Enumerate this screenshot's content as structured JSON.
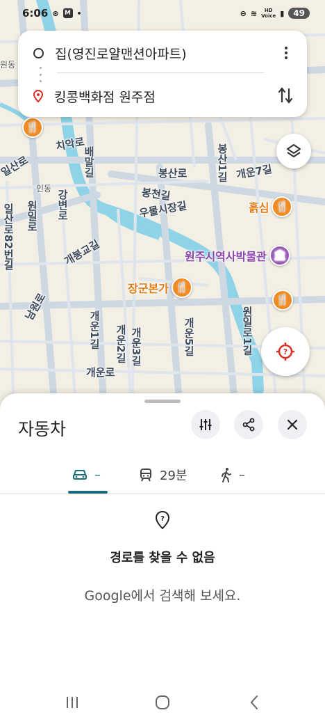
{
  "status_bar": {
    "time": "6:06",
    "battery": "49",
    "hd_label": "HD",
    "voice_label": "Voice",
    "m_badge": "M"
  },
  "route": {
    "origin": "집(영진로얄맨션아파트)",
    "destination": "킹콩백화점 원주점"
  },
  "map": {
    "roads": [
      "봉산로",
      "봉천길",
      "우물시장길",
      "치악로",
      "개봉교길",
      "강변로",
      "인동",
      "일산로",
      "일산로82번길",
      "원일로",
      "남원로",
      "개운로",
      "개운2길",
      "개운3길",
      "개운5길",
      "개운1길",
      "배말길",
      "봉산1길",
      "개운7길",
      "원동",
      "원일로1길"
    ],
    "pois": [
      {
        "name": "흙심",
        "type": "restaurant",
        "color": "#e07b16"
      },
      {
        "name": "원주시역사박물관",
        "type": "museum",
        "color": "#8e44ad"
      },
      {
        "name": "장군본가",
        "type": "restaurant",
        "color": "#e07b16"
      }
    ],
    "map_icons": [
      "layers-icon",
      "my-location-icon"
    ]
  },
  "sheet": {
    "title": "자동차",
    "tabs": [
      {
        "mode": "drive",
        "icon": "car-icon",
        "label": "–"
      },
      {
        "mode": "transit",
        "icon": "train-icon",
        "label": "29분"
      },
      {
        "mode": "walk",
        "icon": "walk-icon",
        "label": "–"
      }
    ],
    "selected_tab": "drive",
    "accent_color": "#1a6e80",
    "no_route_title": "경로를 찾을 수 없음",
    "no_route_subtitle": "Google에서 검색해 보세요."
  }
}
